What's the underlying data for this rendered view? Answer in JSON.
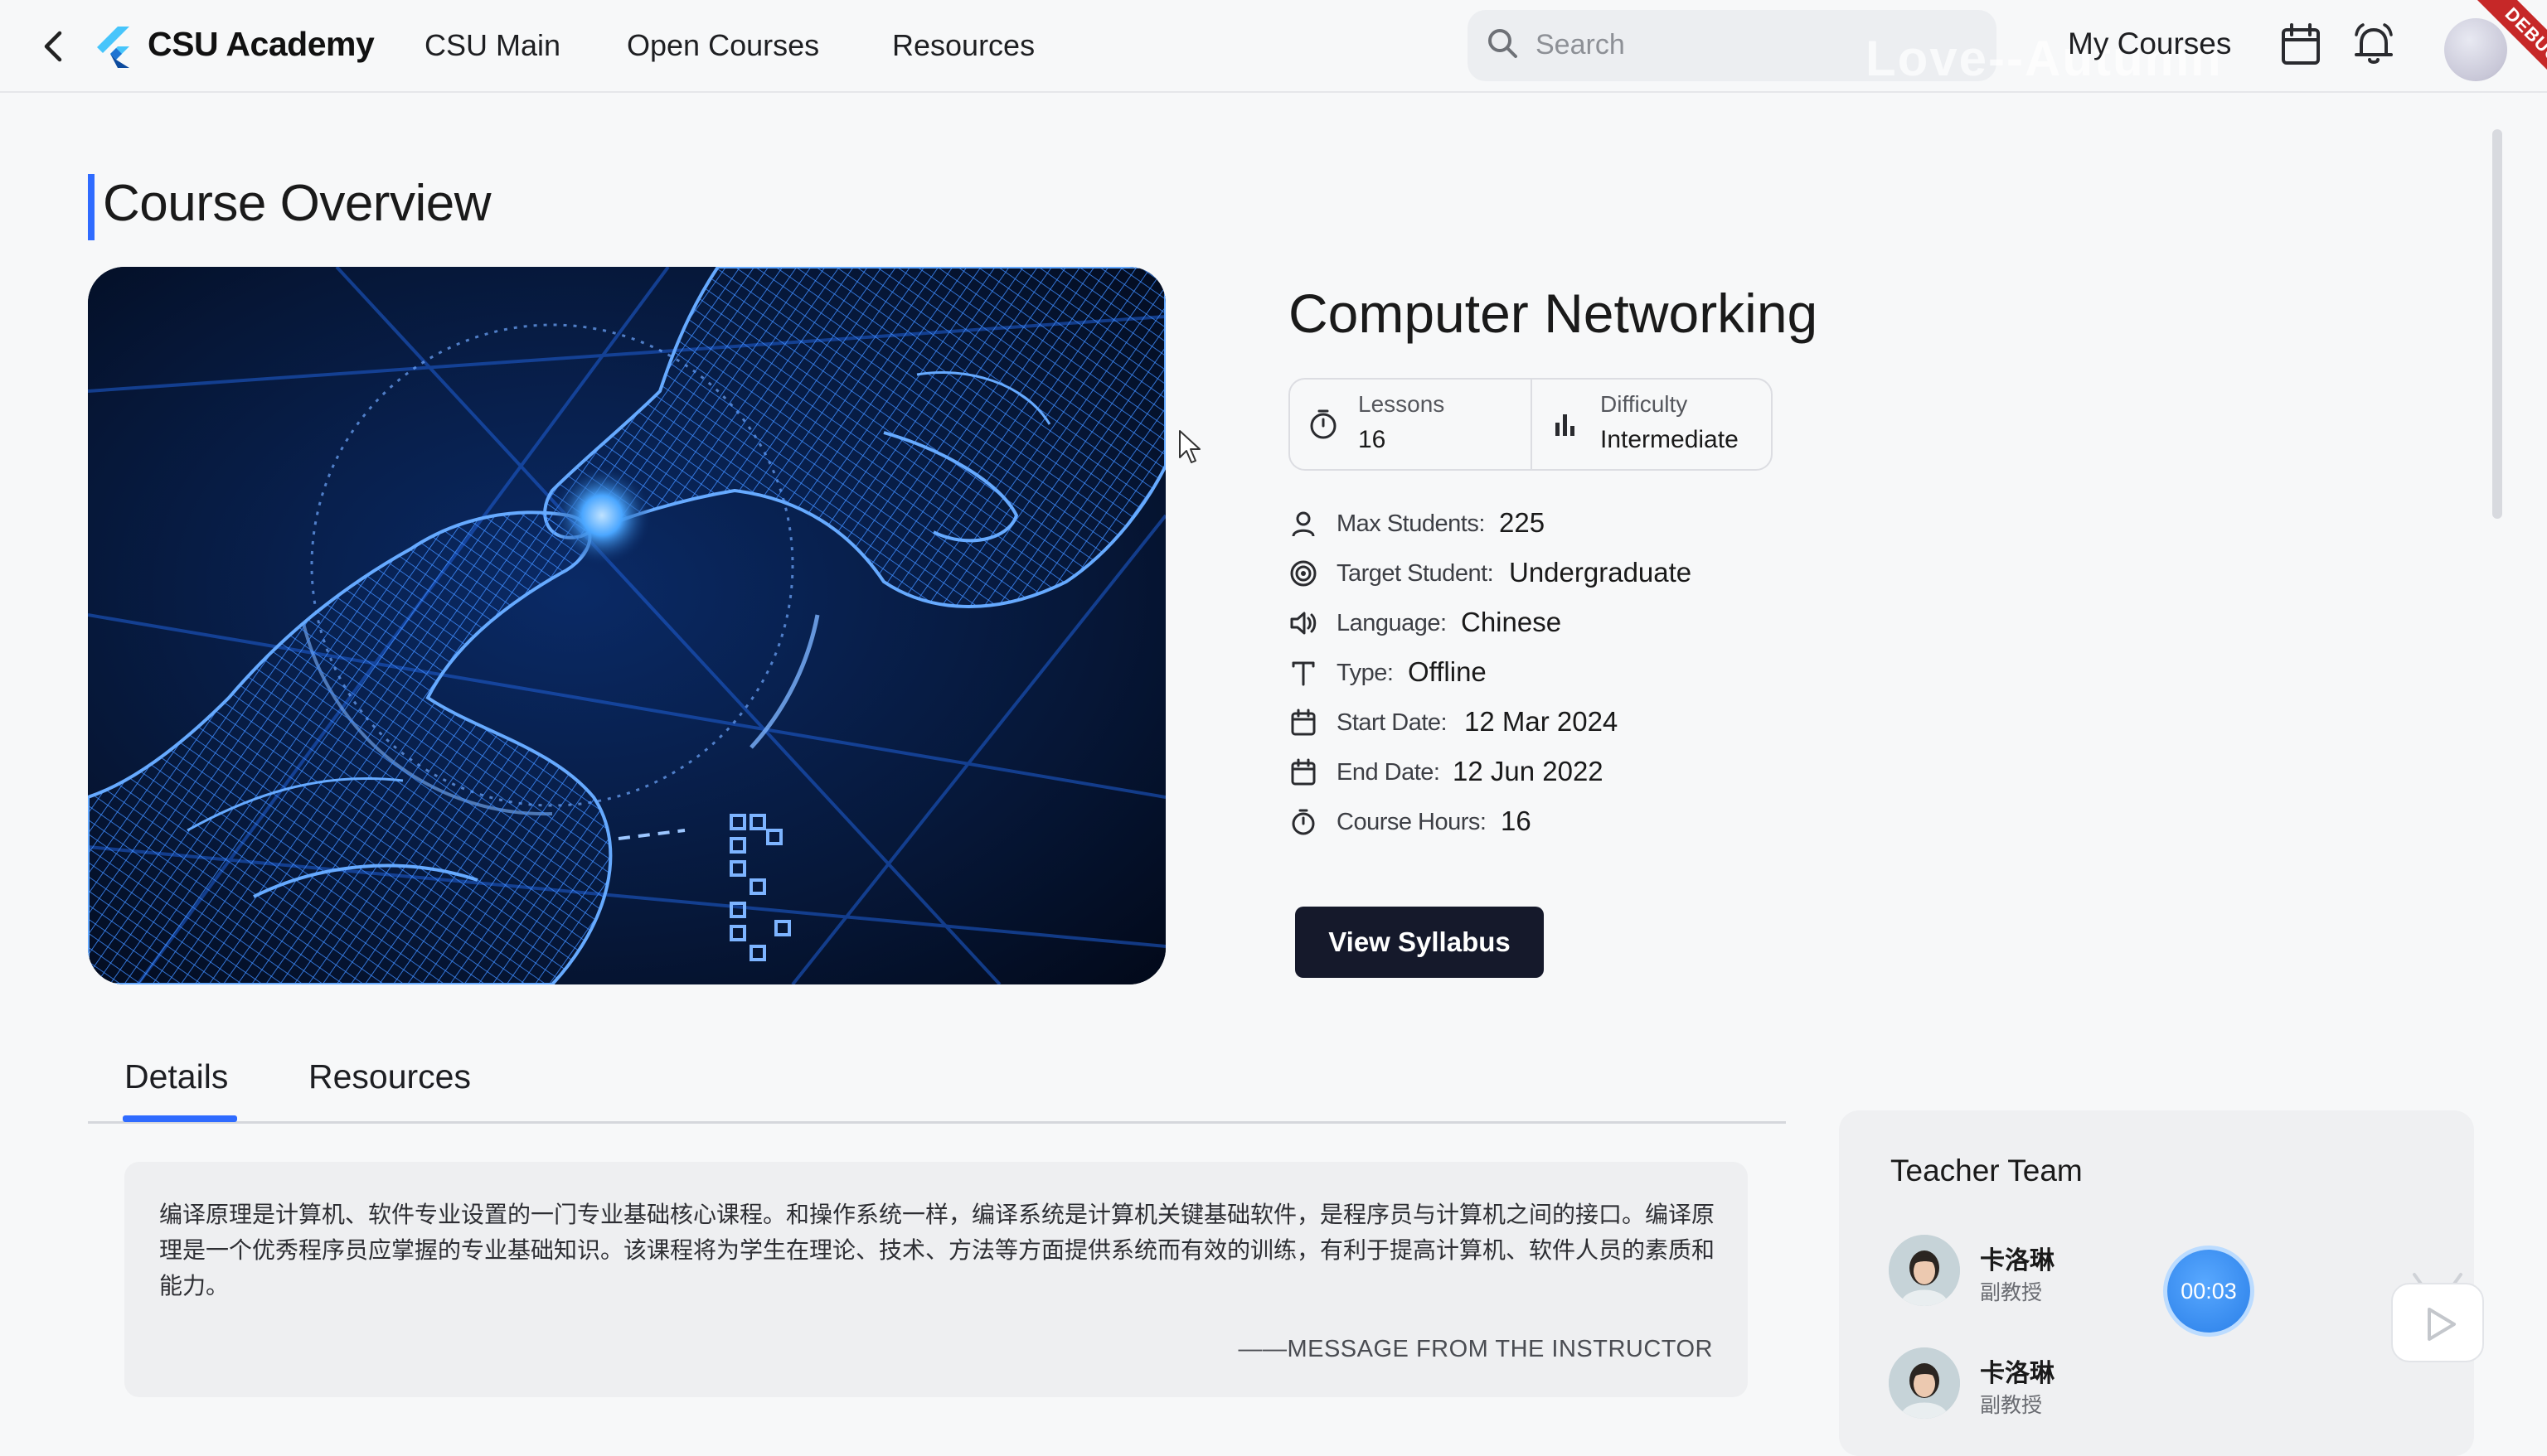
{
  "app": {
    "brand": "CSU Academy",
    "watermark": "Love--Autumn",
    "debug_banner": "DEBUG"
  },
  "nav": {
    "back_icon": "chevron-left-icon",
    "links": [
      "CSU Main",
      "Open Courses",
      "Resources"
    ],
    "search_placeholder": "Search",
    "my_courses": "My Courses",
    "icons": [
      "calendar-icon",
      "bell-icon"
    ]
  },
  "page": {
    "title": "Course Overview"
  },
  "course": {
    "name": "Computer Networking",
    "lessons_label": "Lessons",
    "lessons_value": "16",
    "difficulty_label": "Difficulty",
    "difficulty_value": "Intermediate",
    "details": [
      {
        "icon": "user-icon",
        "label": "Max Students:",
        "value": "225"
      },
      {
        "icon": "target-icon",
        "label": "Target Student:",
        "value": "Undergraduate"
      },
      {
        "icon": "speaker-icon",
        "label": "Language:",
        "value": "Chinese"
      },
      {
        "icon": "text-type-icon",
        "label": "Type:",
        "value": "Offline"
      },
      {
        "icon": "calendar-icon",
        "label": "Start Date:",
        "value": "12 Mar 2024"
      },
      {
        "icon": "calendar-icon",
        "label": "End Date:",
        "value": "12 Jun 2022"
      },
      {
        "icon": "stopwatch-icon",
        "label": "Course Hours:",
        "value": "16"
      }
    ],
    "syllabus_button": "View Syllabus"
  },
  "tabs": {
    "items": [
      "Details",
      "Resources"
    ],
    "active": "Details"
  },
  "message": {
    "text": "编译原理是计算机、软件专业设置的一门专业基础核心课程。和操作系统一样，编译系统是计算机关键基础软件，是程序员与计算机之间的接口。编译原理是一个优秀程序员应掌握的专业基础知识。该课程将为学生在理论、技术、方法等方面提供系统而有效的训练，有利于提高计算机、软件人员的素质和能力。",
    "signature": "——MESSAGE FROM THE INSTRUCTOR"
  },
  "teacher_team": {
    "title": "Teacher Team",
    "members": [
      {
        "name": "卡洛琳",
        "role": "副教授"
      },
      {
        "name": "卡洛琳",
        "role": "副教授"
      }
    ]
  },
  "overlay": {
    "timer": "00:03"
  },
  "colors": {
    "accent": "#2f6bff",
    "button_dark": "#15192b",
    "background": "#f7f8f9"
  }
}
